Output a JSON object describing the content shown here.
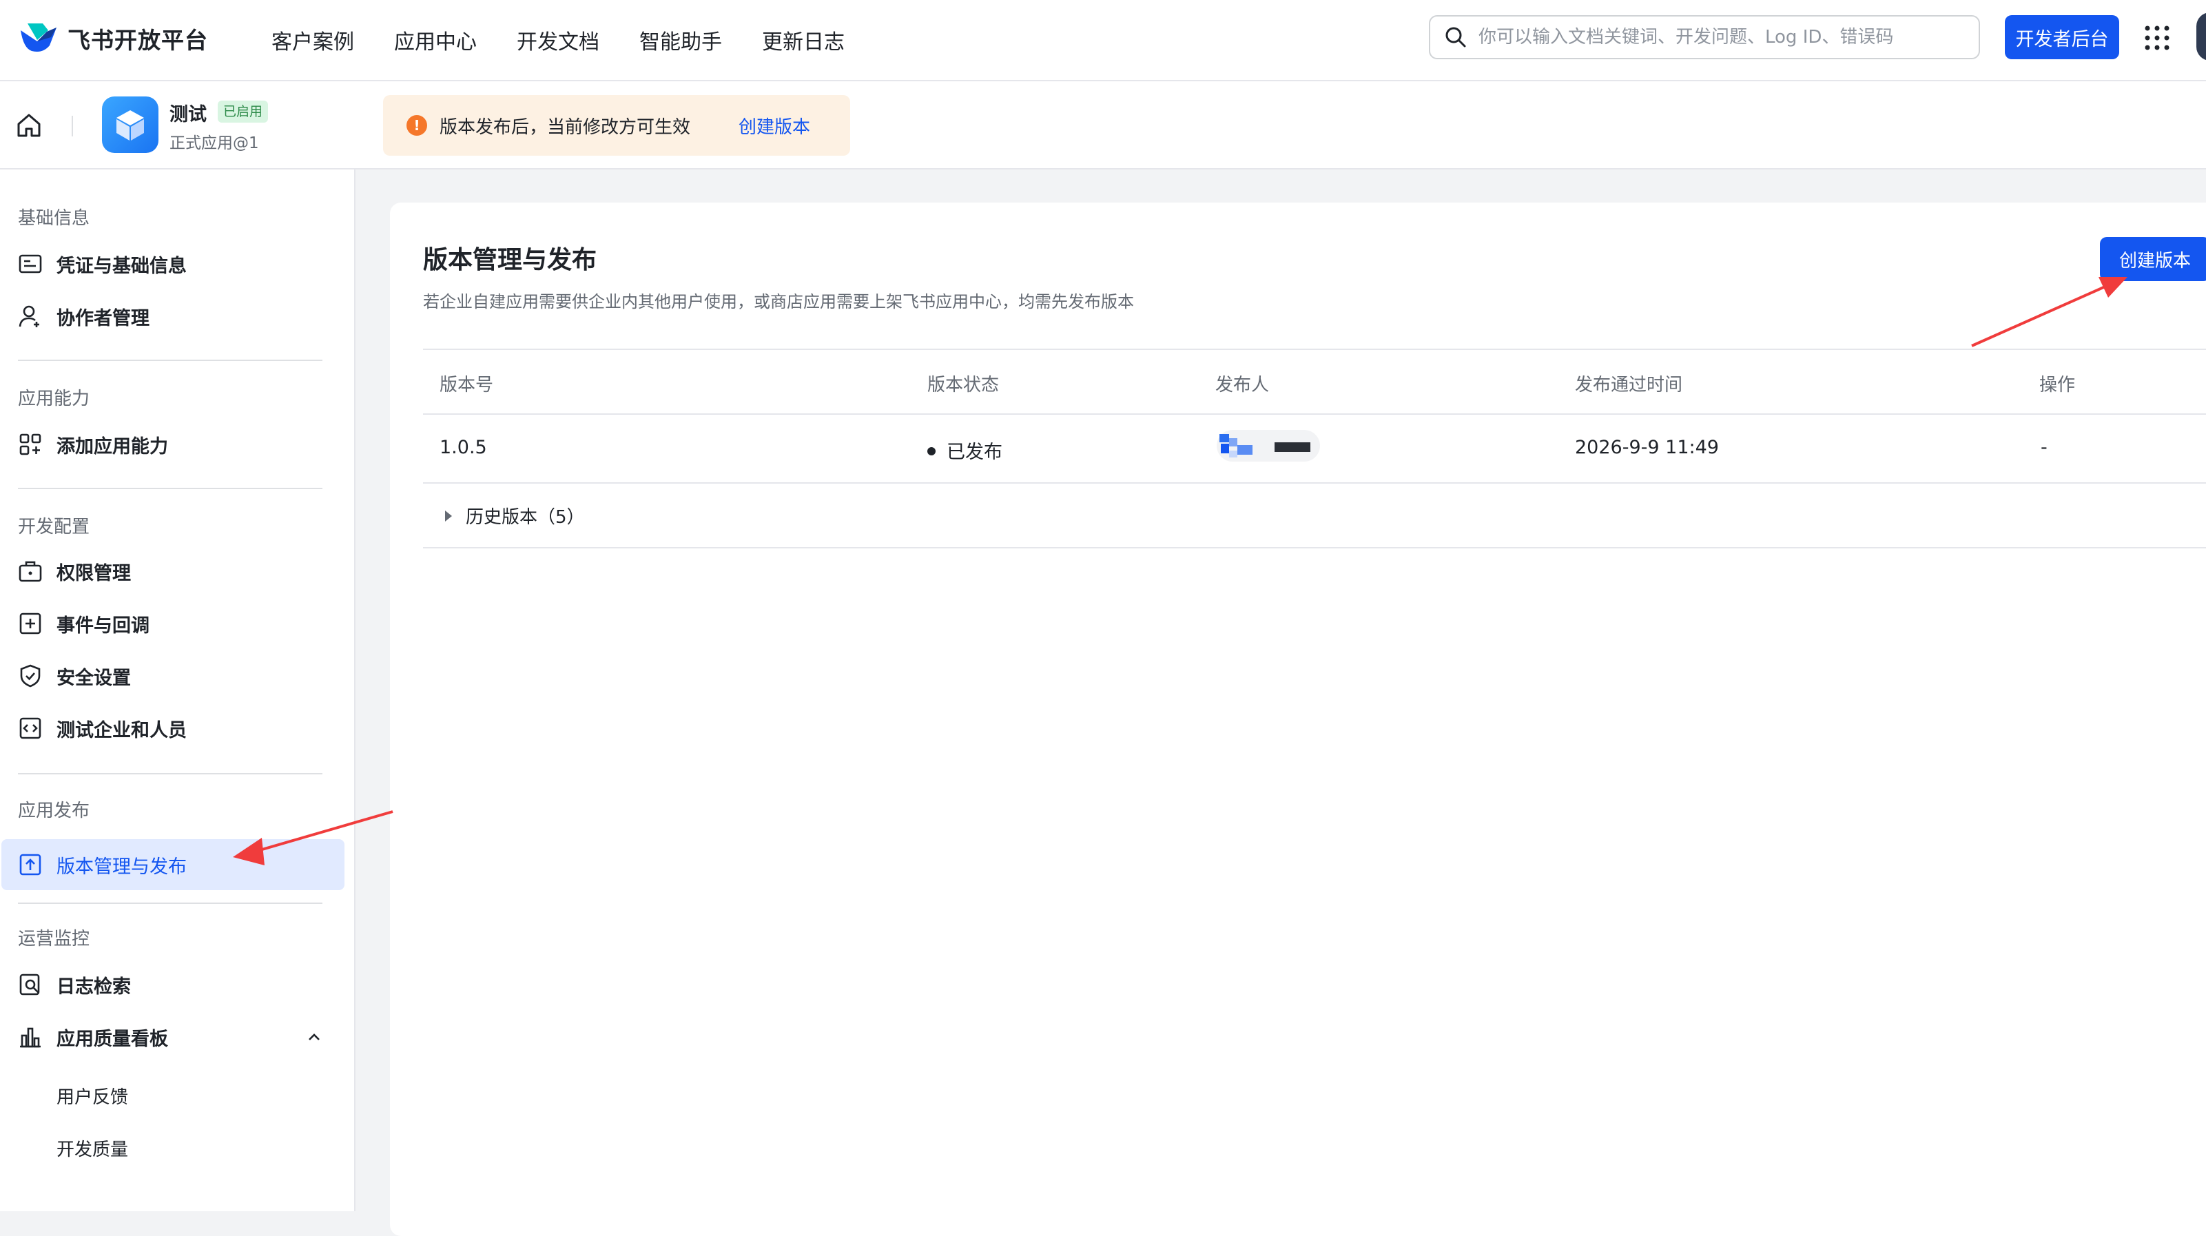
{
  "header": {
    "logo_text": "飞书开放平台",
    "nav": [
      "客户案例",
      "应用中心",
      "开发文档",
      "智能助手",
      "更新日志"
    ],
    "search_placeholder": "你可以输入文档关键词、开发问题、Log ID、错误码",
    "dev_console_label": "开发者后台"
  },
  "app": {
    "name": "测试",
    "status_badge": "已启用",
    "version_label": "正式应用@1"
  },
  "notice": {
    "text": "版本发布后，当前修改方可生效",
    "link": "创建版本"
  },
  "sidebar": {
    "sections": [
      {
        "title": "基础信息",
        "items": [
          "凭证与基础信息",
          "协作者管理"
        ]
      },
      {
        "title": "应用能力",
        "items": [
          "添加应用能力"
        ]
      },
      {
        "title": "开发配置",
        "items": [
          "权限管理",
          "事件与回调",
          "安全设置",
          "测试企业和人员"
        ]
      },
      {
        "title": "应用发布",
        "items": [
          "版本管理与发布"
        ]
      },
      {
        "title": "运营监控",
        "items": [
          "日志检索",
          "应用质量看板"
        ],
        "subitems": [
          "用户反馈",
          "开发质量"
        ]
      }
    ],
    "active_item": "版本管理与发布"
  },
  "main": {
    "title": "版本管理与发布",
    "description": "若企业自建应用需要供企业内其他用户使用，或商店应用需要上架飞书应用中心，均需先发布版本",
    "create_button": "创建版本",
    "table": {
      "columns": [
        "版本号",
        "版本状态",
        "发布人",
        "发布通过时间",
        "操作"
      ],
      "rows": [
        {
          "version": "1.0.5",
          "status": "已发布",
          "publisher": "",
          "time": "2026-9-9 11:49",
          "action": "-"
        }
      ]
    },
    "history_label": "历史版本（5）"
  },
  "colors": {
    "accent": "#1456f0",
    "notice_bg": "#fdf1e3",
    "notice_icon": "#f5772a",
    "annotation_arrow": "#f03c3c"
  }
}
